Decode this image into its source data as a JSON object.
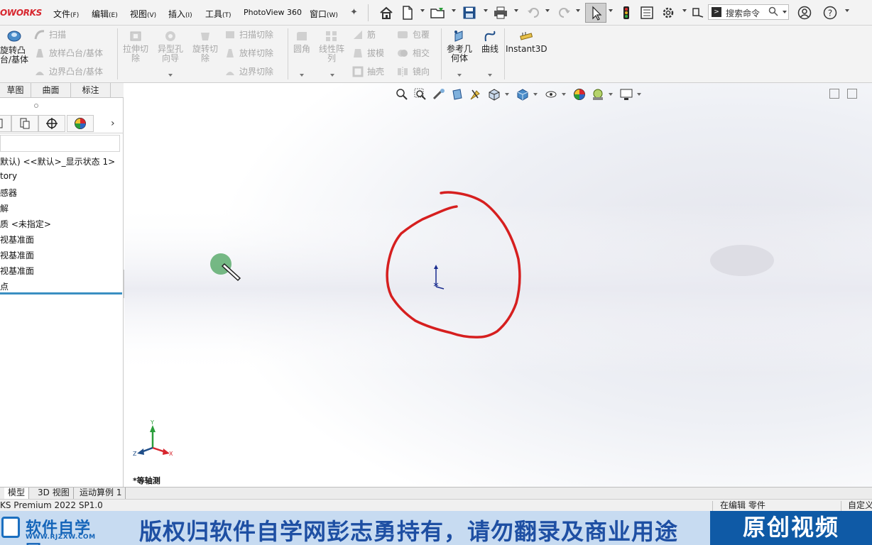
{
  "app": {
    "logo": "OWORKS",
    "menus": [
      {
        "label": "文件",
        "key": "(F)"
      },
      {
        "label": "编辑",
        "key": "(E)"
      },
      {
        "label": "视图",
        "key": "(V)"
      },
      {
        "label": "插入",
        "key": "(I)"
      },
      {
        "label": "工具",
        "key": "(T)"
      },
      {
        "label": "PhotoView 360",
        "key": ""
      },
      {
        "label": "窗口",
        "key": "(W)"
      }
    ],
    "search_placeholder": "搜索命令"
  },
  "ribbon": {
    "revolve_boss": "旋转凸\n台/基体",
    "sweep": "扫描",
    "loft_boss": "放样凸台/基体",
    "boundary_boss": "边界凸台/基体",
    "extrude_cut": "拉伸切\n除",
    "hole_wizard": "异型孔\n向导",
    "revolve_cut": "旋转切\n除",
    "swept_cut": "扫描切除",
    "lofted_cut": "放样切除",
    "boundary_cut": "边界切除",
    "fillet": "圆角",
    "linear_pattern": "线性阵\n列",
    "rib": "筋",
    "draft": "拔模",
    "shell": "抽壳",
    "wrap": "包覆",
    "intersect": "相交",
    "mirror": "镜向",
    "ref_geometry": "参考几\n何体",
    "curves": "曲线",
    "instant3d": "Instant3D"
  },
  "cm_tabs": [
    "草图",
    "曲面",
    "标注"
  ],
  "feature_tree": {
    "items": [
      "默认) <<默认>_显示状态 1>",
      "tory",
      "感器",
      "解",
      "质 <未指定>",
      "视基准面",
      "视基准面",
      "视基准面",
      "点"
    ]
  },
  "graphics": {
    "view_name": "*等轴测",
    "triad": {
      "x": "X",
      "y": "Y",
      "z": "Z"
    }
  },
  "model_tabs": [
    "模型",
    "3D 视图",
    "运动算例 1"
  ],
  "status": {
    "product": "KS Premium 2022 SP1.0",
    "editing": "在编辑 零件",
    "custom": "自定义"
  },
  "banner": {
    "logo_name": "软件自学网",
    "logo_url": "WWW.RJZXW.COM",
    "text": "版权归软件自学网彭志勇持有，请勿翻录及商业用途",
    "tag": "原创视频"
  },
  "colors": {
    "annotation": "#d61f1f",
    "accent_blue": "#1e4fa3",
    "logo_red": "#d7262e"
  }
}
